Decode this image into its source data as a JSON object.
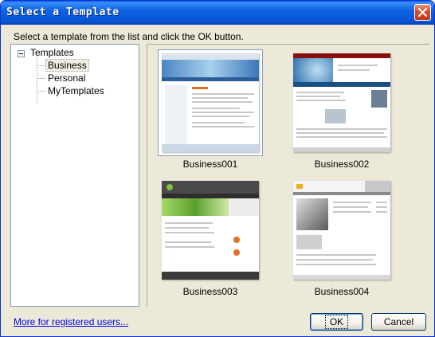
{
  "window": {
    "title": "Select a Template",
    "instruction": "Select a template from the list and click the OK button."
  },
  "tree": {
    "root": "Templates",
    "items": [
      {
        "label": "Business",
        "selected": true
      },
      {
        "label": "Personal",
        "selected": false
      },
      {
        "label": "MyTemplates",
        "selected": false
      }
    ]
  },
  "gallery": {
    "templates": [
      {
        "name": "Business001",
        "selected": true
      },
      {
        "name": "Business002",
        "selected": false
      },
      {
        "name": "Business003",
        "selected": false
      },
      {
        "name": "Business004",
        "selected": false
      }
    ]
  },
  "footer": {
    "link": "More for registered users...",
    "ok_label": "OK",
    "cancel_label": "Cancel"
  },
  "colors": {
    "titlebar_blue": "#0a5dd8",
    "close_red": "#d5512d",
    "link_blue": "#0000ee"
  }
}
